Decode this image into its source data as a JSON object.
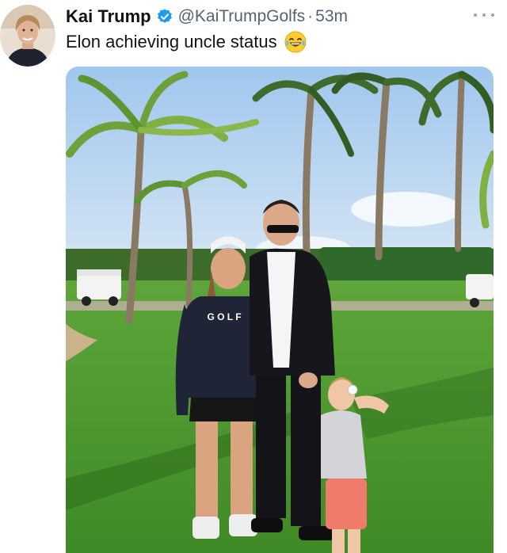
{
  "tweet": {
    "author_name": "Kai Trump",
    "handle": "@KaiTrumpGolfs",
    "separator": "·",
    "time": "53m",
    "text": "Elon achieving uncle status",
    "emoji": "laughing-tears-emoji",
    "verified": true
  },
  "media": {
    "shirt_print": "G O L F"
  },
  "icons": {
    "verified": "verified-badge-icon",
    "more": "more-options-icon"
  },
  "colors": {
    "verified_blue": "#1d9bf0",
    "secondary_text": "#536471",
    "primary_text": "#0f1419"
  }
}
